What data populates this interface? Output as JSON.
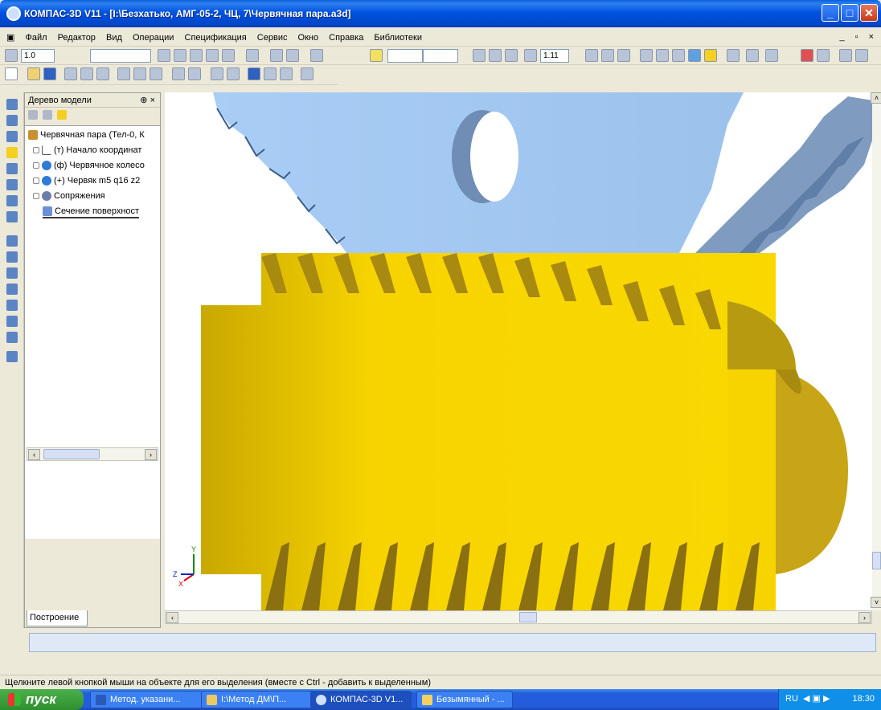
{
  "window": {
    "title": "КОМПАС-3D V11 - [I:\\Безхатько, АМГ-05-2, ЧЦ, 7\\Червячная пара.a3d]"
  },
  "menu": {
    "items": [
      "Файл",
      "Редактор",
      "Вид",
      "Операции",
      "Спецификация",
      "Сервис",
      "Окно",
      "Справка",
      "Библиотеки"
    ]
  },
  "toolbar": {
    "scale_value": "1.0",
    "zoom_value": "1.11"
  },
  "tree": {
    "header": "Дерево модели",
    "items": [
      {
        "label": "Червячная пара (Тел-0, К"
      },
      {
        "label": "(т) Начало координат"
      },
      {
        "label": "(ф) Червячное колесо"
      },
      {
        "label": "(+) Червяк m5 q16 z2"
      },
      {
        "label": "Сопряжения"
      },
      {
        "label": "Сечение поверхност"
      }
    ],
    "tab_label": "Построение"
  },
  "axes": {
    "x": "X",
    "y": "Y",
    "z": "Z"
  },
  "status": {
    "text": "Щелкните левой кнопкой мыши на объекте для его выделения (вместе с Ctrl - добавить к выделенным)"
  },
  "taskbar": {
    "start_label": "пуск",
    "tasks": [
      "Метод. указани...",
      "I:\\Метод ДМ\\П...",
      "КОМПАС-3D V1...",
      "Безымянный - ..."
    ],
    "lang": "RU",
    "clock": "18:30"
  },
  "colors": {
    "gear": "#a9cdf5",
    "worm": "#f7d400",
    "worm_dark": "#a88a10"
  }
}
